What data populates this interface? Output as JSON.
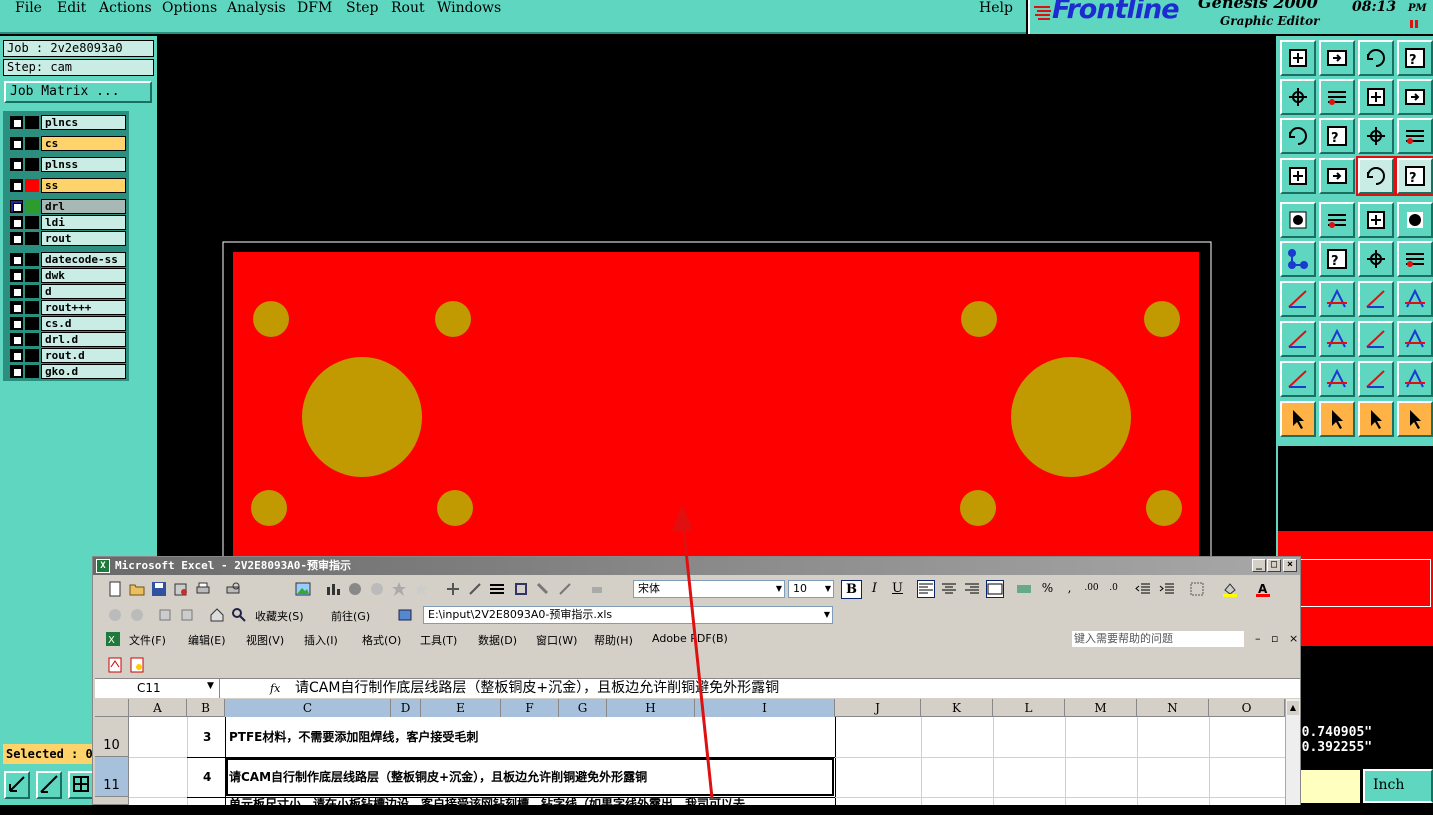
{
  "menubar": {
    "items": [
      "File",
      "Edit",
      "Actions",
      "Options",
      "Analysis",
      "DFM",
      "Step",
      "Rout",
      "Windows"
    ],
    "help": "Help"
  },
  "brand": {
    "logo": "Frontline",
    "product": "Genesis 2000",
    "subtitle": "Graphic Editor",
    "time": "08:13",
    "ampm": "PM"
  },
  "left": {
    "job": "Job : 2v2e8093a0",
    "step": "Step: cam",
    "job_matrix": "Job Matrix ...",
    "layers": [
      {
        "name": "plncs",
        "swatch": "#000000",
        "bg": "#c9ece4"
      },
      {
        "name": "cs",
        "swatch": "#000000",
        "bg": "#ffd36b"
      },
      {
        "name": "plnss",
        "swatch": "#000000",
        "bg": "#c9ece4"
      },
      {
        "name": "ss",
        "swatch": "#ff0000",
        "bg": "#ffd36b"
      },
      {
        "name": "drl",
        "swatch": "#2e9b2e",
        "bg": "#a8b8b4"
      },
      {
        "name": "ldi",
        "swatch": "#000000",
        "bg": "#c9ece4"
      },
      {
        "name": "rout",
        "swatch": "#000000",
        "bg": "#c9ece4"
      },
      {
        "name": "datecode-ss",
        "swatch": "#000000",
        "bg": "#c9ece4"
      },
      {
        "name": "dwk",
        "swatch": "#000000",
        "bg": "#c9ece4"
      },
      {
        "name": "d",
        "swatch": "#000000",
        "bg": "#c9ece4"
      },
      {
        "name": "rout+++",
        "swatch": "#000000",
        "bg": "#c9ece4"
      },
      {
        "name": "cs.d",
        "swatch": "#000000",
        "bg": "#c9ece4"
      },
      {
        "name": "drl.d",
        "swatch": "#000000",
        "bg": "#c9ece4"
      },
      {
        "name": "rout.d",
        "swatch": "#000000",
        "bg": "#c9ece4"
      },
      {
        "name": "gko.d",
        "swatch": "#000000",
        "bg": "#c9ece4"
      }
    ],
    "selected": "Selected : 0"
  },
  "right": {
    "coord_x": "= 0.740905\"",
    "coord_y": "= 0.392255\"",
    "units": "Inch"
  },
  "colors": {
    "board_red": "#ff0000",
    "pad_gold": "#c09a00",
    "panel_teal": "#5fd6c0",
    "arrow_red": "#e01010"
  },
  "excel": {
    "title": "Microsoft Excel - 2V2E8093A0-预审指示",
    "font_name": "宋体",
    "font_size": "10",
    "favorites": "收藏夹(S)",
    "goto": "前往(G)",
    "path": "E:\\input\\2V2E8093A0-预审指示.xls",
    "menus": [
      "文件(F)",
      "编辑(E)",
      "视图(V)",
      "插入(I)",
      "格式(O)",
      "工具(T)",
      "数据(D)",
      "窗口(W)",
      "帮助(H)",
      "Adobe PDF(B)"
    ],
    "help_placeholder": "键入需要帮助的问题",
    "name_box": "C11",
    "fx": "fx",
    "formula": "请CAM自行制作底层线路层（整板铜皮+沉金），且板边允许削铜避免外形露铜",
    "columns": [
      "A",
      "B",
      "C",
      "D",
      "E",
      "F",
      "G",
      "H",
      "I",
      "J",
      "K",
      "L",
      "M",
      "N",
      "O"
    ],
    "rows": [
      {
        "num": "10",
        "b": "3",
        "c": "PTFE材料，不需要添加阻焊线，客户接受毛刺"
      },
      {
        "num": "11",
        "b": "4",
        "c": "请CAM自行制作底层线路层（整板铜皮+沉金），且板边允许削铜避免外形露铜"
      },
      {
        "num": "",
        "b": "",
        "c": "单元板尺寸小，请在小板钻槽边设，客户接受该网钻刻槽，钻字线（如果字线外露出，我司可以去"
      }
    ]
  }
}
